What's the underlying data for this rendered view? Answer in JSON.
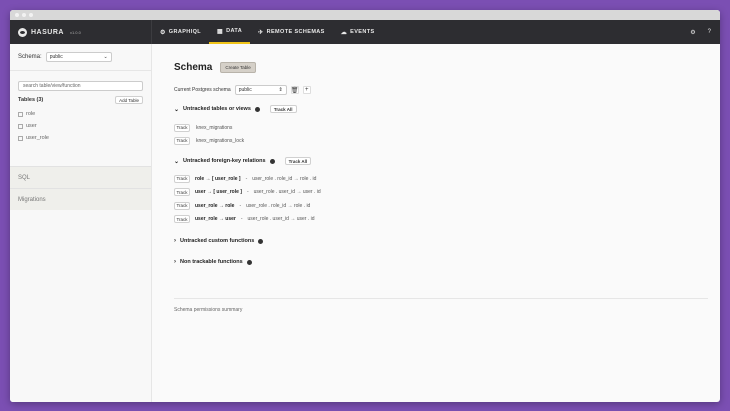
{
  "navbar": {
    "brand": "HASURA",
    "version": "v1.0.0",
    "tabs": [
      {
        "label": "GRAPHIQL",
        "icon": "⚙"
      },
      {
        "label": "DATA",
        "icon": "▦"
      },
      {
        "label": "REMOTE SCHEMAS",
        "icon": "✈"
      },
      {
        "label": "EVENTS",
        "icon": "☁"
      }
    ],
    "settings_icon": "⚙",
    "help_icon": "?"
  },
  "sidebar": {
    "schema_label": "Schema:",
    "schema_value": "public",
    "search_placeholder": "search table/view/function",
    "tables_heading": "Tables (3)",
    "add_table_label": "Add Table",
    "tables": [
      "role",
      "user",
      "user_role"
    ],
    "sql_label": "SQL",
    "migrations_label": "Migrations"
  },
  "main": {
    "title": "Schema",
    "create_table_label": "Create Table",
    "current_schema_label": "Current Postgres schema",
    "current_schema_value": "public",
    "untracked_heading": "Untracked tables or views",
    "track_all_label": "Track All",
    "track_label": "Track",
    "untracked_tables": [
      "knex_migrations",
      "knex_migrations_lock"
    ],
    "fk_heading": "Untracked foreign-key relations",
    "fk_relations": [
      {
        "rel": "role → [ user_role ]",
        "sep": "-",
        "cols": "user_role . role_id  → role . id"
      },
      {
        "rel": "user → [ user_role ]",
        "sep": "-",
        "cols": "user_role . user_id  → user . id"
      },
      {
        "rel": "user_role → role",
        "sep": "-",
        "cols": "user_role . role_id  → role . id"
      },
      {
        "rel": "user_role → user",
        "sep": "-",
        "cols": "user_role . user_id  → user . id"
      }
    ],
    "functions_heading": "Untracked custom functions",
    "nontrackable_heading": "Non trackable functions",
    "summary_label": "Schema permissions summary"
  }
}
